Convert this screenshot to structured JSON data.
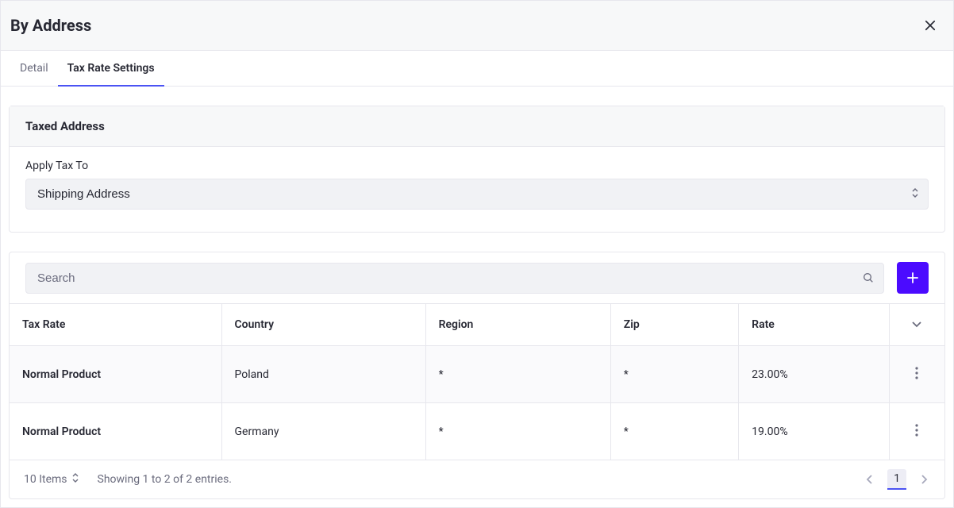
{
  "header": {
    "title": "By Address"
  },
  "tabs": {
    "detail": "Detail",
    "settings": "Tax Rate Settings"
  },
  "taxed_address": {
    "card_title": "Taxed Address",
    "apply_label": "Apply Tax To",
    "apply_value": "Shipping Address"
  },
  "search": {
    "placeholder": "Search"
  },
  "table": {
    "headers": {
      "tax_rate": "Tax Rate",
      "country": "Country",
      "region": "Region",
      "zip": "Zip",
      "rate": "Rate"
    },
    "rows": [
      {
        "name": "Normal Product",
        "country": "Poland",
        "region": "*",
        "zip": "*",
        "rate": "23.00%"
      },
      {
        "name": "Normal Product",
        "country": "Germany",
        "region": "*",
        "zip": "*",
        "rate": "19.00%"
      }
    ]
  },
  "footer": {
    "page_size": "10 Items",
    "entries": "Showing 1 to 2 of 2 entries.",
    "current_page": "1"
  }
}
